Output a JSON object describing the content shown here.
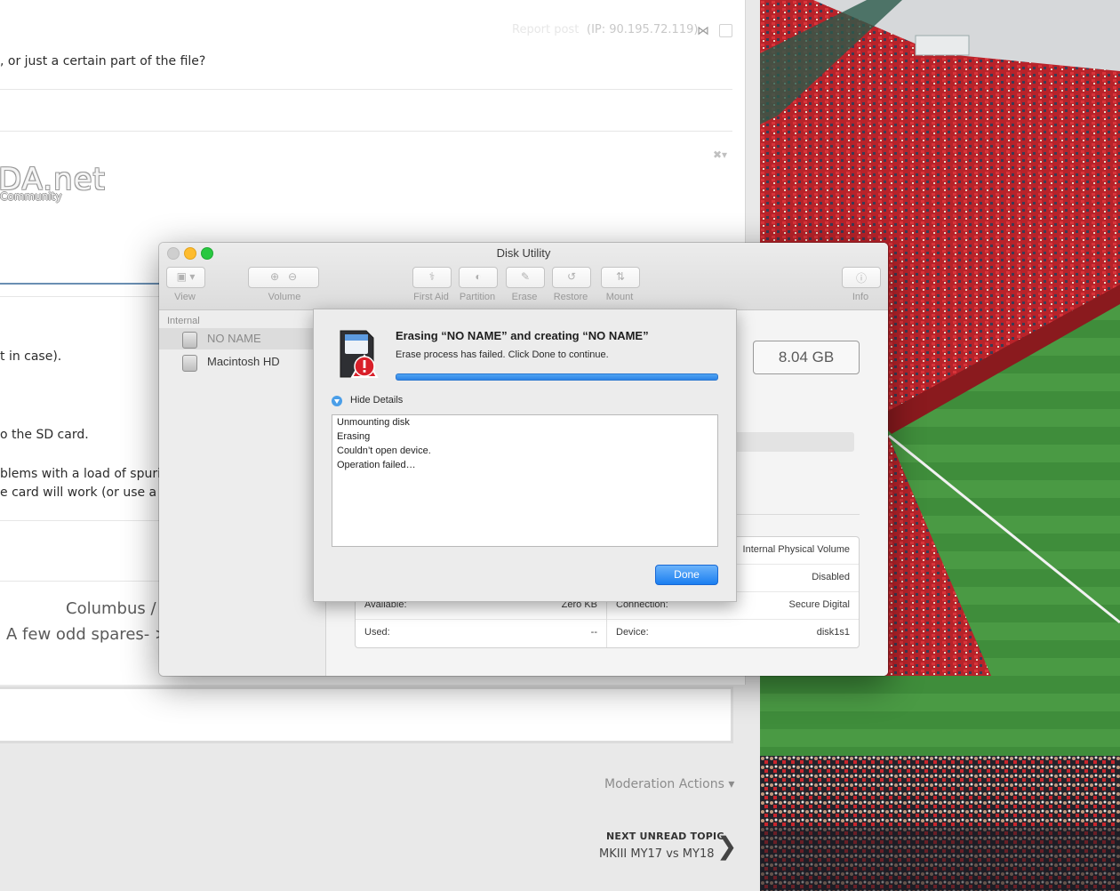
{
  "forum": {
    "report_post": "Report post",
    "ip": "(IP: 90.195.72.119)",
    "question": ", or just a certain part of the file?",
    "logo_text": "DA.net",
    "logo_sub": "Community",
    "body_lines": [
      "t in case).",
      "o the SD card.",
      "blems with a load of spuriou",
      "e card will work (or use a W"
    ],
    "signature_1": "Columbus / I",
    "signature_2": "A few odd spares- >",
    "moderation_actions": "Moderation Actions ▾",
    "next_unread_heading": "NEXT UNREAD TOPIC",
    "next_unread_title": "MKIII MY17 vs MY18"
  },
  "disk_utility": {
    "window_title": "Disk Utility",
    "toolbar": {
      "view": "View",
      "volume": "Volume",
      "first_aid": "First Aid",
      "partition": "Partition",
      "erase": "Erase",
      "restore": "Restore",
      "mount": "Mount",
      "info": "Info"
    },
    "sidebar": {
      "heading": "Internal",
      "items": [
        {
          "label": "NO NAME",
          "selected": true
        },
        {
          "label": "Macintosh HD",
          "selected": false
        }
      ]
    },
    "capacity": "8.04 GB",
    "info_table": {
      "left": [
        {
          "key": "Available:",
          "value": "Zero KB"
        },
        {
          "key": "Used:",
          "value": "--"
        }
      ],
      "right": [
        {
          "key": "",
          "value": "Internal Physical Volume"
        },
        {
          "key": "",
          "value": "Disabled"
        },
        {
          "key": "Connection:",
          "value": "Secure Digital"
        },
        {
          "key": "Device:",
          "value": "disk1s1"
        }
      ]
    },
    "sheet": {
      "title": "Erasing “NO NAME” and creating “NO NAME”",
      "message": "Erase process has failed. Click Done to continue.",
      "progress": 1.0,
      "hide_details": "Hide Details",
      "log": [
        "Unmounting disk",
        "Erasing",
        "Couldn’t open device.",
        "Operation failed…"
      ],
      "done": "Done"
    }
  },
  "colors": {
    "accent_blue": "#2e84e6",
    "error_red": "#d9202a",
    "stadium_seats": "#c8262d",
    "pitch": "#3e8a3a"
  }
}
